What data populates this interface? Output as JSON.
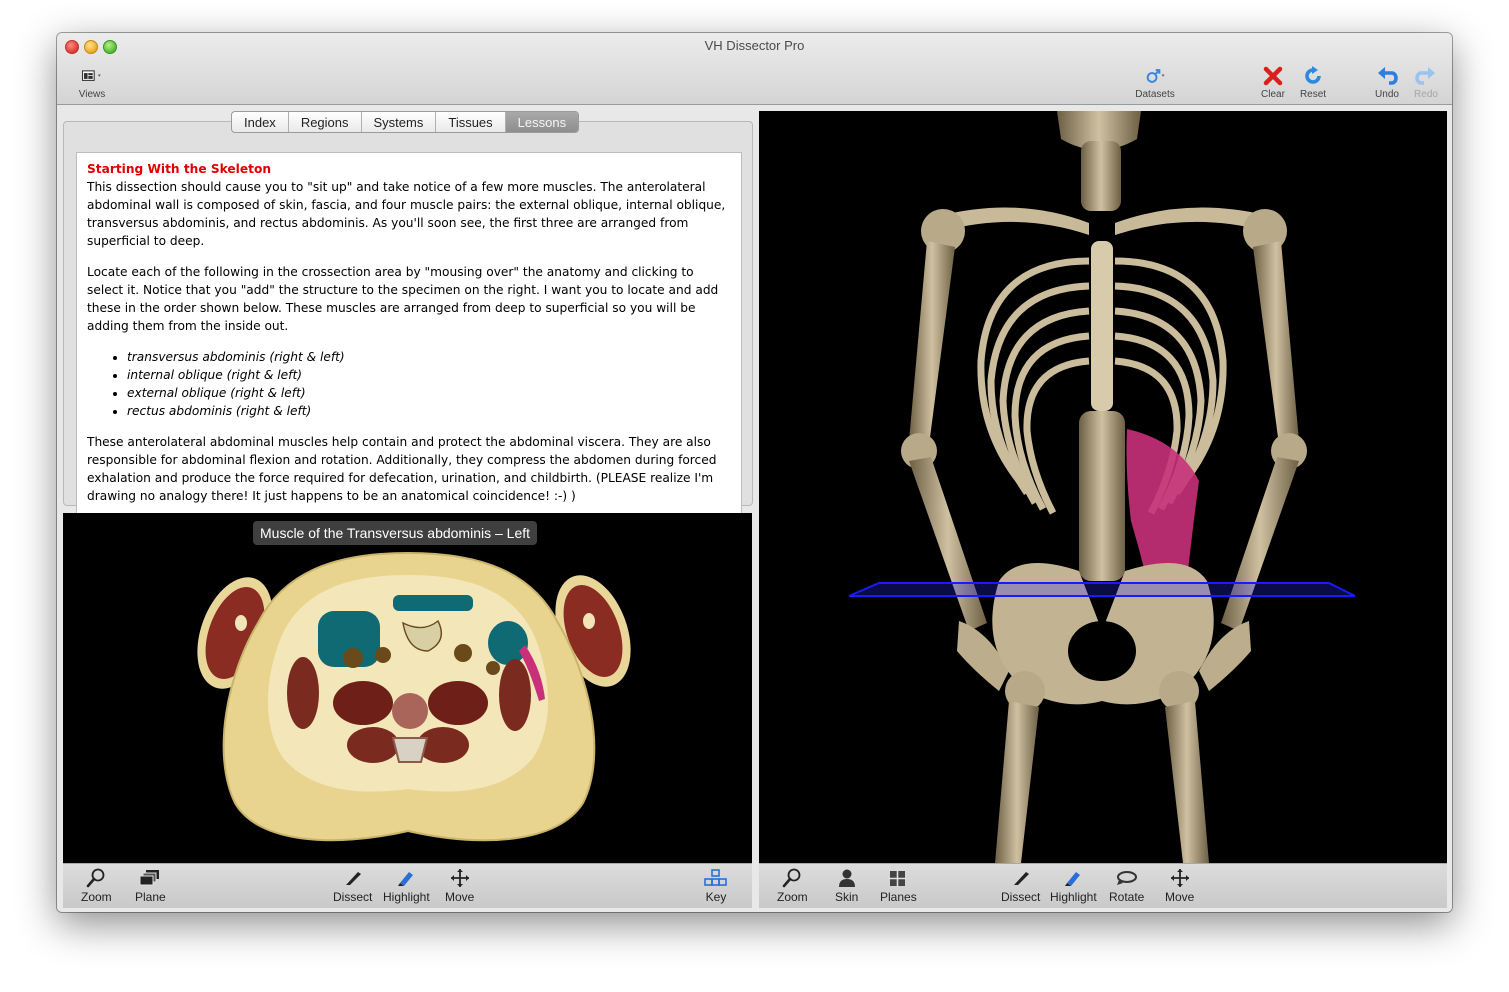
{
  "window": {
    "title": "VH Dissector Pro"
  },
  "toolbar": {
    "views_label": "Views",
    "datasets_label": "Datasets",
    "clear_label": "Clear",
    "reset_label": "Reset",
    "undo_label": "Undo",
    "redo_label": "Redo"
  },
  "tabs": [
    {
      "label": "Index"
    },
    {
      "label": "Regions"
    },
    {
      "label": "Systems"
    },
    {
      "label": "Tissues"
    },
    {
      "label": "Lessons"
    }
  ],
  "lesson": {
    "title": "Starting With the Skeleton",
    "para1": "This dissection should cause you to \"sit up\" and take notice of a few more muscles. The anterolateral abdominal wall is composed of skin, fascia, and four muscle pairs: the external oblique, internal oblique, transversus abdominis, and rectus abdominis. As you'll soon see, the first three are arranged from superficial to deep.",
    "para2": "Locate each of the following in the crossection area by \"mousing over\" the anatomy and clicking to select it. Notice that you \"add\" the structure to the specimen on the right. I want you to locate and add these in the order shown below. These muscles are arranged from deep to superficial so you will be adding them from the inside out.",
    "items": [
      "transversus abdominis (right & left)",
      "internal oblique (right & left)",
      "external oblique (right & left)",
      "rectus abdominis (right & left)"
    ],
    "para3": "These anterolateral abdominal muscles help contain and protect the abdominal viscera. They are also responsible for abdominal flexion and rotation. Additionally, they compress the abdomen during forced exhalation and produce the force required for defecation, urination, and childbirth. (PLEASE realize I'm drawing no analogy there! It just happens to be an anatomical coincidence! :-) )"
  },
  "crosssection": {
    "label": "Muscle of the Transversus abdominis – Left"
  },
  "left_tools": {
    "zoom": "Zoom",
    "plane": "Plane",
    "dissect": "Dissect",
    "highlight": "Highlight",
    "move": "Move",
    "key": "Key"
  },
  "right_tools": {
    "zoom": "Zoom",
    "skin": "Skin",
    "planes": "Planes",
    "dissect": "Dissect",
    "highlight": "Highlight",
    "rotate": "Rotate",
    "move": "Move"
  },
  "colors": {
    "lesson_title": "#e00000",
    "highlight_tool": "#2a6fd6",
    "plane": "#1a1aff",
    "highlighted_muscle": "#c8317a"
  }
}
